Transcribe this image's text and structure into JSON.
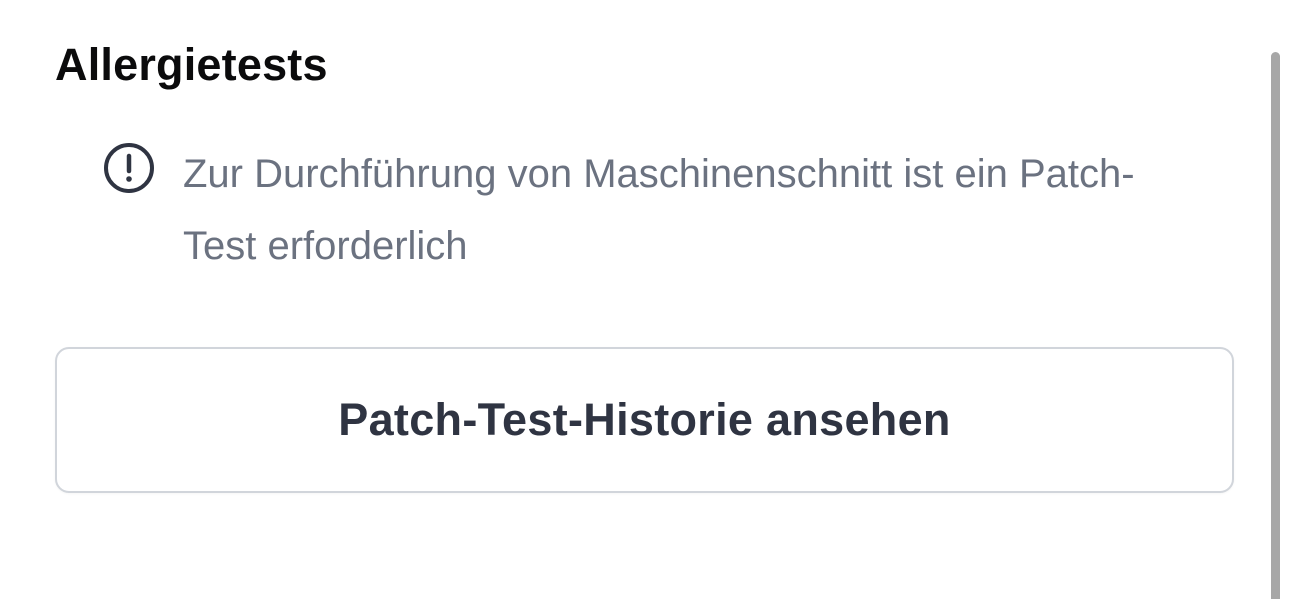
{
  "section": {
    "title": "Allergietests"
  },
  "notice": {
    "icon": "exclamation-circle-icon",
    "text": "Zur Durchführung von Maschinenschnitt ist ein Patch-Test erforderlich"
  },
  "actions": {
    "history_button_label": "Patch-Test-Historie ansehen"
  },
  "colors": {
    "title": "#0b0b0c",
    "notice_text": "#6b7280",
    "icon": "#2f3442",
    "button_border": "#d1d5db",
    "button_text": "#2f3442",
    "scrollbar": "#a7a7a7"
  }
}
